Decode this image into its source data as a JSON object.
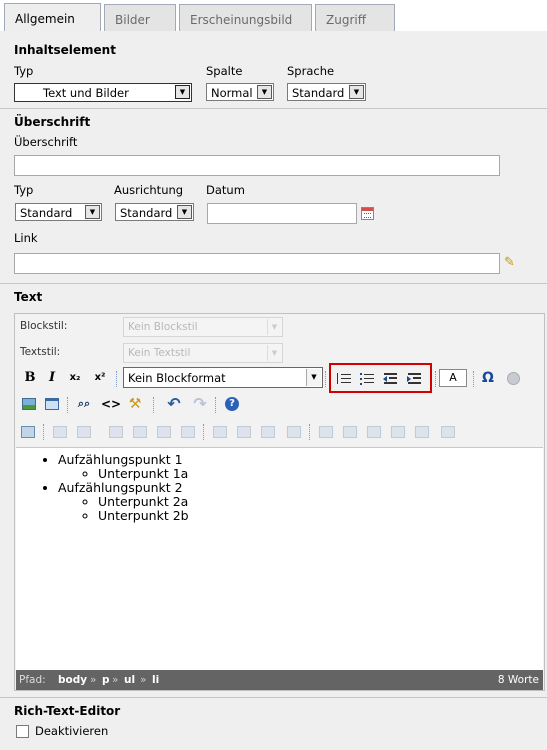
{
  "tabs": [
    "Allgemein",
    "Bilder",
    "Erscheinungsbild",
    "Zugriff"
  ],
  "inhalt": {
    "heading": "Inhaltselement",
    "typ_label": "Typ",
    "typ_value": "Text und Bilder",
    "spalte_label": "Spalte",
    "spalte_value": "Normal",
    "sprache_label": "Sprache",
    "sprache_value": "Standard"
  },
  "ueberschrift": {
    "heading": "Überschrift",
    "field_label": "Überschrift",
    "typ_label": "Typ",
    "typ_value": "Standard",
    "ausrichtung_label": "Ausrichtung",
    "ausrichtung_value": "Standard",
    "datum_label": "Datum",
    "link_label": "Link"
  },
  "text": {
    "heading": "Text",
    "blockstil_label": "Blockstil:",
    "blockstil_value": "Kein Blockstil",
    "textstil_label": "Textstil:",
    "textstil_value": "Kein Textstil",
    "blockformat_value": "Kein Blockformat"
  },
  "toolbar": {
    "bold": "B",
    "italic": "I",
    "sub": "x₂",
    "sup": "x²",
    "font_color": "A",
    "omega": "Ω",
    "source": "<>",
    "undo": "↶",
    "help": "?",
    "find": "🔍"
  },
  "editor_content": [
    {
      "text": "Aufzählungspunkt 1",
      "children": [
        "Unterpunkt 1a"
      ]
    },
    {
      "text": "Aufzählungspunkt 2",
      "children": [
        "Unterpunkt 2a",
        "Unterpunkt 2b"
      ]
    }
  ],
  "status": {
    "path_label": "Pfad:",
    "path": [
      "body",
      "p",
      "ul",
      "li"
    ],
    "sep": "»",
    "words": "8 Worte"
  },
  "rte": {
    "heading": "Rich-Text-Editor",
    "checkbox_label": "Deaktivieren",
    "checked": false
  },
  "colors": {
    "highlight_box": "#d40000",
    "status_bar": "#646464",
    "panel": "#efefef"
  }
}
